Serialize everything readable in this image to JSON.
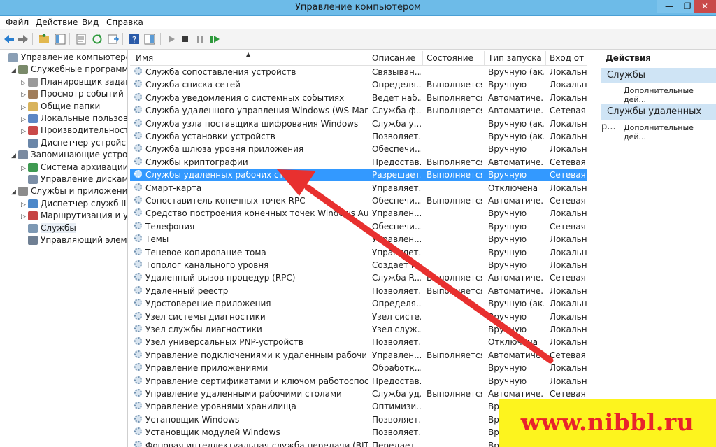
{
  "window": {
    "title": "Управление компьютером",
    "min": "—",
    "max": "❐",
    "close": "✕"
  },
  "menu": [
    "Файл",
    "Действие",
    "Вид",
    "Справка"
  ],
  "tree": [
    {
      "label": "Управление компьютером (л",
      "level": 0,
      "twisty": "",
      "icon": "#8a9fb5"
    },
    {
      "label": "Служебные программы",
      "level": 1,
      "twisty": "◢",
      "icon": "#7a8a6a"
    },
    {
      "label": "Планировщик заданий",
      "level": 2,
      "twisty": "▷",
      "icon": "#9a9a9a"
    },
    {
      "label": "Просмотр событий",
      "level": 2,
      "twisty": "▷",
      "icon": "#a07d5a"
    },
    {
      "label": "Общие папки",
      "level": 2,
      "twisty": "▷",
      "icon": "#d8b35c"
    },
    {
      "label": "Локальные пользовате",
      "level": 2,
      "twisty": "▷",
      "icon": "#5c86c4"
    },
    {
      "label": "Производительность",
      "level": 2,
      "twisty": "▷",
      "icon": "#c94a4a"
    },
    {
      "label": "Диспетчер устройств",
      "level": 2,
      "twisty": "",
      "icon": "#6a86a8"
    },
    {
      "label": "Запоминающие устройст",
      "level": 1,
      "twisty": "◢",
      "icon": "#7a8aa0"
    },
    {
      "label": "Система архивации да",
      "level": 2,
      "twisty": "▷",
      "icon": "#3f9a52"
    },
    {
      "label": "Управление дисками",
      "level": 2,
      "twisty": "",
      "icon": "#7b8ea6"
    },
    {
      "label": "Службы и приложения",
      "level": 1,
      "twisty": "◢",
      "icon": "#8c8c8c"
    },
    {
      "label": "Диспетчер служб IIS",
      "level": 2,
      "twisty": "▷",
      "icon": "#4d88c9"
    },
    {
      "label": "Маршрутизация и уда",
      "level": 2,
      "twisty": "▷",
      "icon": "#c64444"
    },
    {
      "label": "Службы",
      "level": 2,
      "twisty": "",
      "icon": "#7d98b3",
      "selected": true
    },
    {
      "label": "Управляющий элемен",
      "level": 2,
      "twisty": "",
      "icon": "#6f7f93"
    }
  ],
  "columns": [
    "Имя",
    "Описание",
    "Состояние",
    "Тип запуска",
    "Вход от им"
  ],
  "services": [
    [
      "Служба сопоставления устройств",
      "Связыван...",
      "",
      "Вручную (ак...",
      "Локальна..."
    ],
    [
      "Служба списка сетей",
      "Определя...",
      "Выполняется",
      "Вручную",
      "Локальна..."
    ],
    [
      "Служба уведомления о системных событиях",
      "Ведет наб...",
      "Выполняется",
      "Автоматиче...",
      "Локальна..."
    ],
    [
      "Служба удаленного управления Windows (WS-Managem...",
      "Служба ф...",
      "Выполняется",
      "Автоматиче...",
      "Сетевая с..."
    ],
    [
      "Служба узла поставщика шифрования Windows",
      "Служба у...",
      "",
      "Вручную (ак...",
      "Локальна..."
    ],
    [
      "Служба установки устройств",
      "Позволяет...",
      "",
      "Вручную (ак...",
      "Локальна..."
    ],
    [
      "Служба шлюза уровня приложения",
      "Обеспечи...",
      "",
      "Вручную",
      "Локальна..."
    ],
    [
      "Службы криптографии",
      "Предостав...",
      "Выполняется",
      "Автоматиче...",
      "Сетевая с..."
    ],
    [
      "Службы удаленных рабочих столов",
      "Разрешает...",
      "Выполняется",
      "Вручную",
      "Сетевая с..."
    ],
    [
      "Смарт-карта",
      "Управляет...",
      "",
      "Отключена",
      "Локальна..."
    ],
    [
      "Сопоставитель конечных точек RPC",
      "Обеспечи...",
      "Выполняется",
      "Автоматиче...",
      "Сетевая с..."
    ],
    [
      "Средство построения конечных точек Windows Audio",
      "Управлен...",
      "",
      "Вручную",
      "Локальна..."
    ],
    [
      "Телефония",
      "Обеспечи...",
      "",
      "Вручную",
      "Сетевая с..."
    ],
    [
      "Темы",
      "Управлен...",
      "",
      "Вручную",
      "Локальна..."
    ],
    [
      "Теневое копирование тома",
      "Управляет...",
      "",
      "Вручную",
      "Локальна..."
    ],
    [
      "Тополог канального уровня",
      "Создает к...",
      "",
      "Вручную",
      "Локальна..."
    ],
    [
      "Удаленный вызов процедур (RPC)",
      "Служба R...",
      "Выполняется",
      "Автоматиче...",
      "Сетевая с..."
    ],
    [
      "Удаленный реестр",
      "Позволяет...",
      "Выполняется",
      "Автоматиче...",
      "Локальна..."
    ],
    [
      "Удостоверение приложения",
      "Определя...",
      "",
      "Вручную (ак...",
      "Локальна..."
    ],
    [
      "Узел системы диагностики",
      "Узел систе...",
      "",
      "Вручную",
      "Локальна..."
    ],
    [
      "Узел службы диагностики",
      "Узел служ...",
      "",
      "Вручную",
      "Локальна..."
    ],
    [
      "Узел универсальных PNP-устройств",
      "Позволяет...",
      "",
      "Отключена",
      "Локальна..."
    ],
    [
      "Управление подключениями к удаленным рабочим стола...",
      "Управлен...",
      "Выполняется",
      "Автоматиче...",
      "Сетевая с..."
    ],
    [
      "Управление приложениями",
      "Обработк...",
      "",
      "Вручную",
      "Локальна..."
    ],
    [
      "Управление сертификатами и ключом работоспособнос...",
      "Предостав...",
      "",
      "Вручную",
      "Локальна..."
    ],
    [
      "Управление удаленными рабочими столами",
      "Служба уд...",
      "Выполняется",
      "Автоматиче...",
      "Сетевая с..."
    ],
    [
      "Управление уровнями хранилища",
      "Оптимизи...",
      "",
      "Вр...",
      ""
    ],
    [
      "Установщик Windows",
      "Позволяет...",
      "",
      "Вр...",
      ""
    ],
    [
      "Установщик модулей Windows",
      "Позволяет...",
      "",
      "Вр...",
      ""
    ],
    [
      "Фоновая интеллектуальная служба передачи (BITS)",
      "Передает ...",
      "",
      "Вр...",
      ""
    ]
  ],
  "selected_service_index": 8,
  "actions": {
    "title": "Действия",
    "groups": [
      {
        "header": "Службы",
        "link": "Дополнительные дей..."
      },
      {
        "header": "Службы удаленных р...",
        "link": "Дополнительные дей..."
      }
    ]
  },
  "watermark": "www.nibbl.ru",
  "colors": {
    "titlebar": "#6dbbe8",
    "selection": "#3399ff",
    "arrow": "#e8302f",
    "banner": "#fdf41e"
  }
}
